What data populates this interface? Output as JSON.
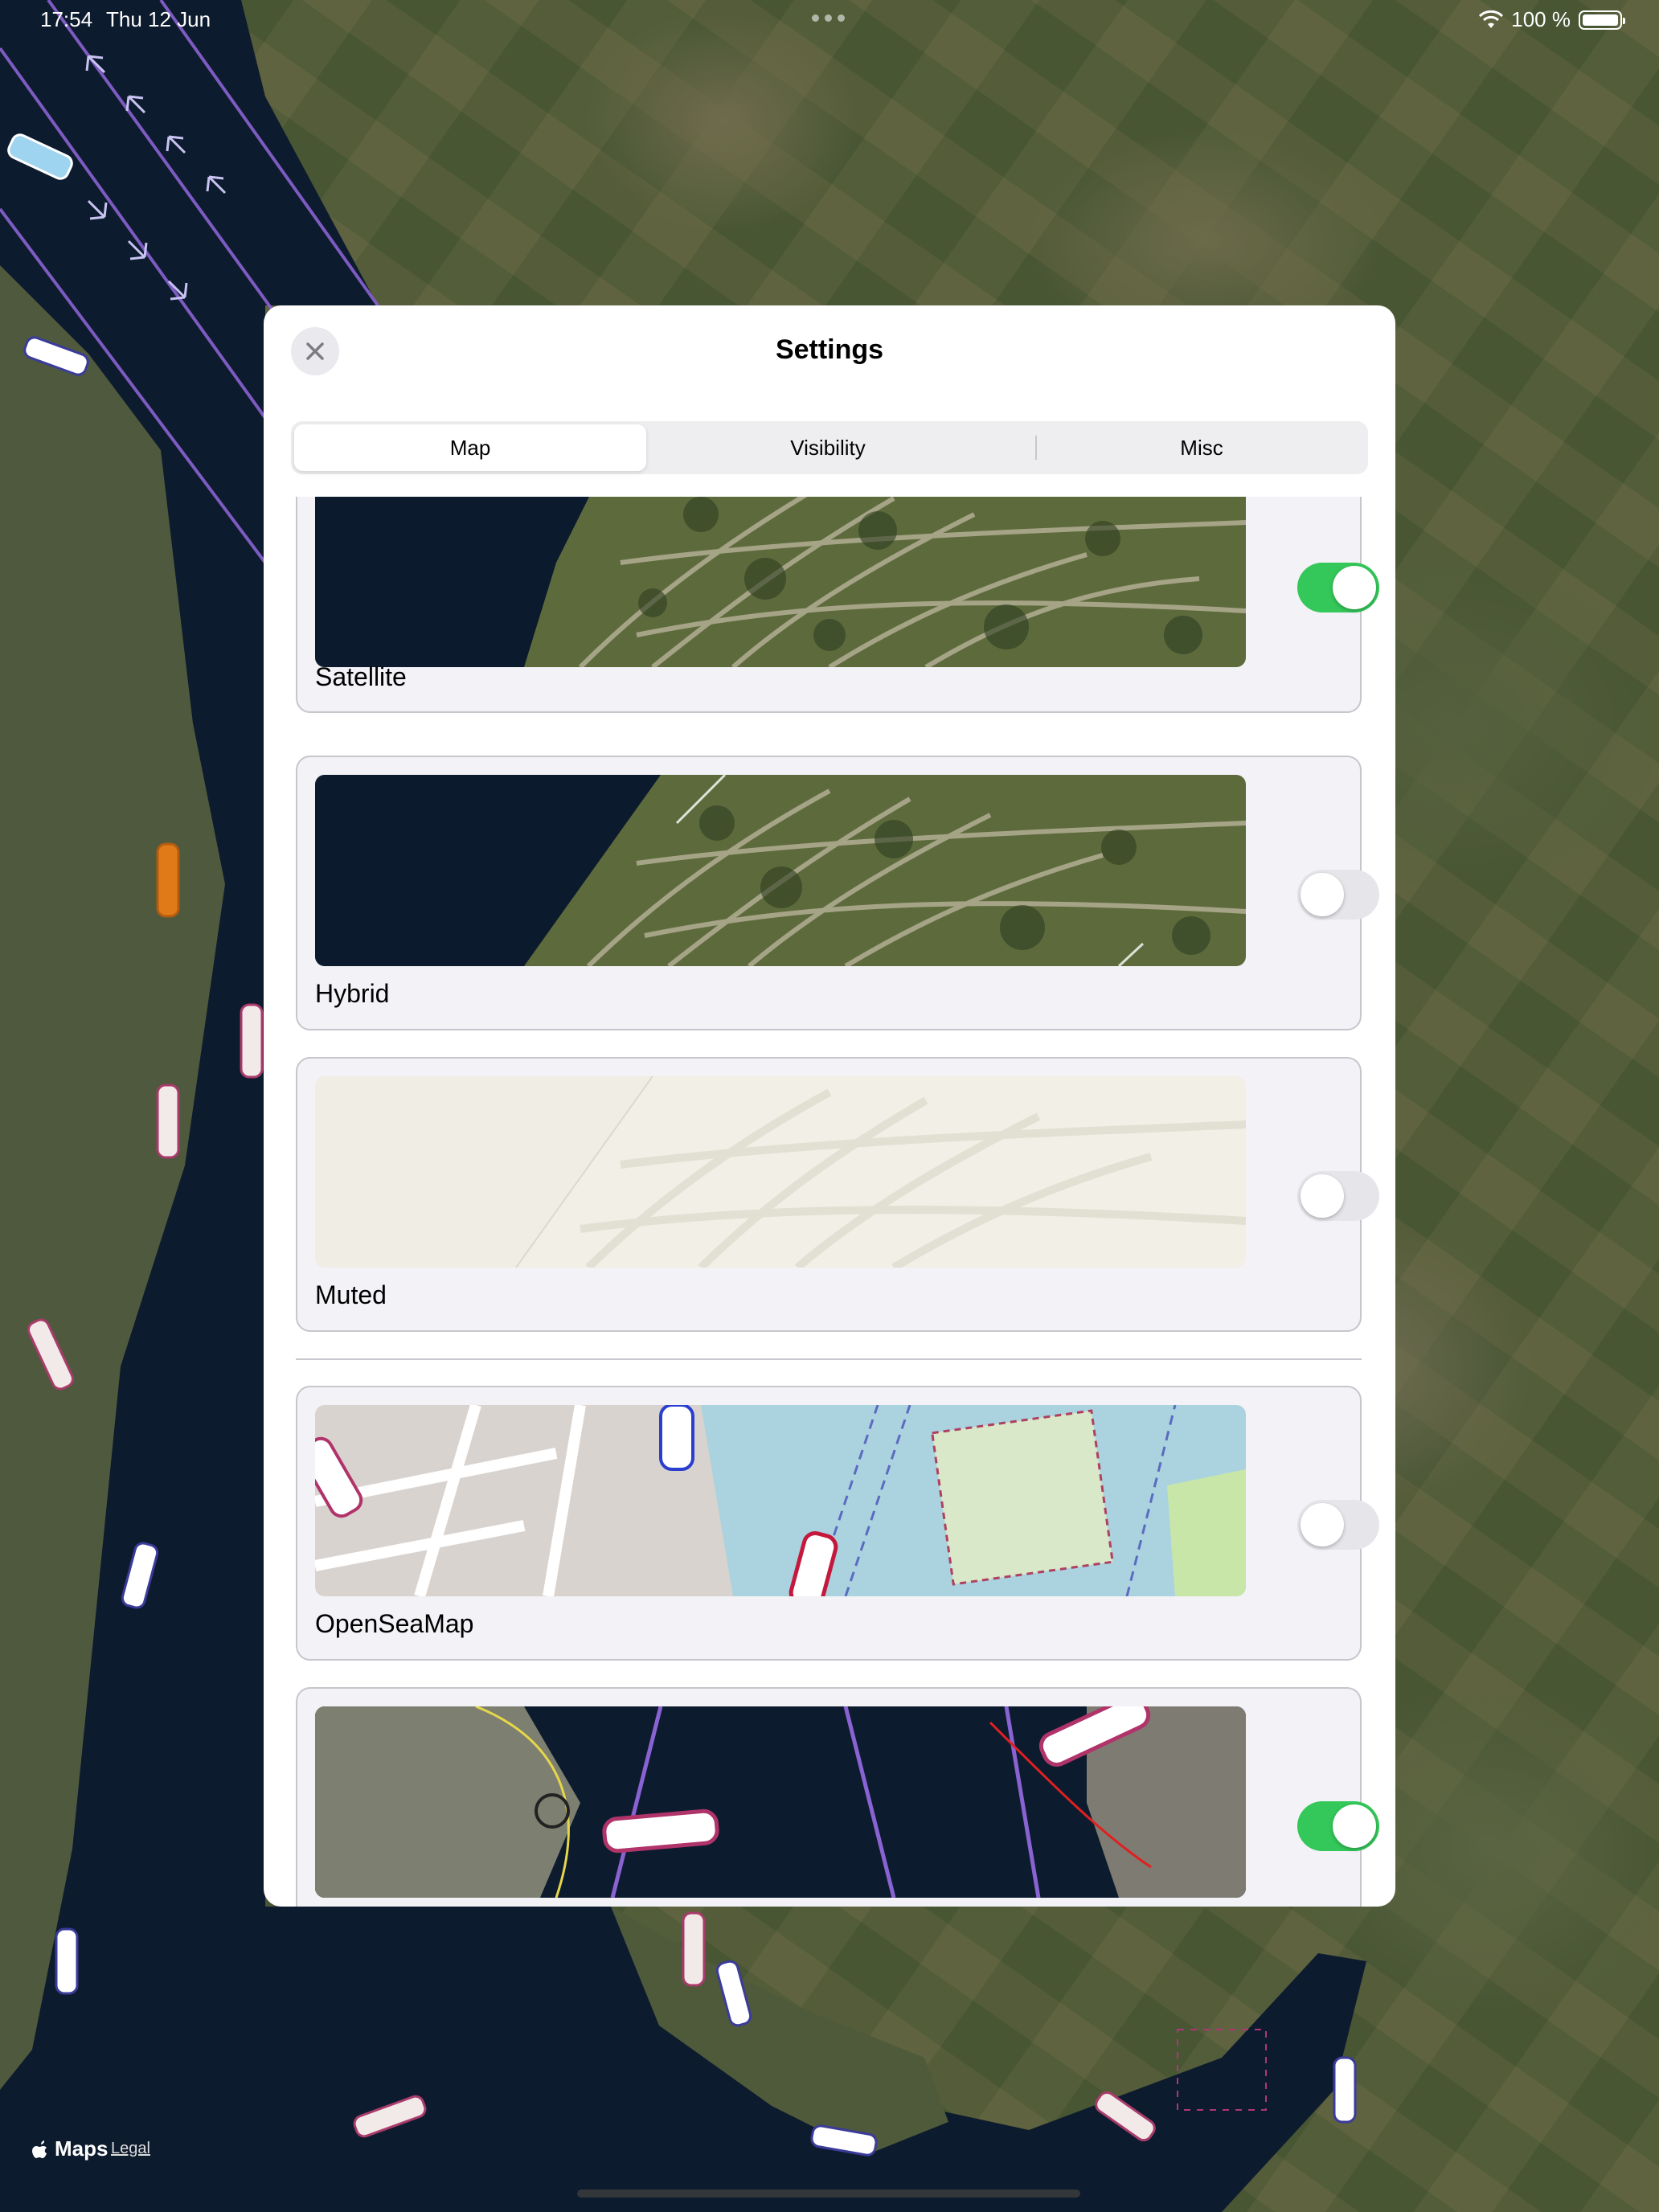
{
  "status_bar": {
    "time": "17:54",
    "date": "Thu 12 Jun",
    "battery": "100 %"
  },
  "map": {
    "attribution": "Maps",
    "legal": "Legal"
  },
  "settings": {
    "title": "Settings",
    "tabs": [
      {
        "label": "Map",
        "selected": true
      },
      {
        "label": "Visibility",
        "selected": false
      },
      {
        "label": "Misc",
        "selected": false
      }
    ],
    "base_maps": [
      {
        "label": "Satellite",
        "enabled": true
      },
      {
        "label": "Hybrid",
        "enabled": false
      },
      {
        "label": "Muted",
        "enabled": false
      }
    ],
    "overlays": [
      {
        "label": "OpenSeaMap",
        "enabled": false
      },
      {
        "label": "",
        "enabled": true
      }
    ]
  },
  "colors": {
    "accent_toggle_on": "#34c759",
    "water": "#0d1b2e",
    "fairway_line": "#8a63d2"
  },
  "icons": [
    "close-icon",
    "wifi-icon",
    "battery-icon",
    "apple-maps-logo-icon"
  ]
}
